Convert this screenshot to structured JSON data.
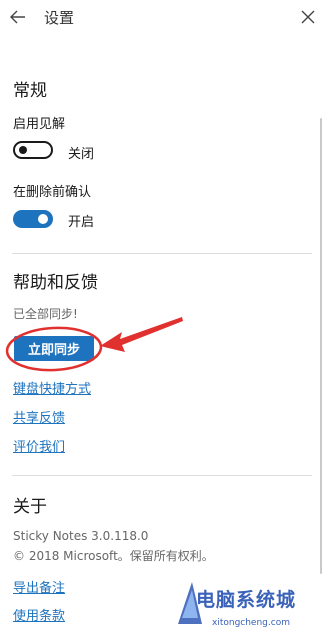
{
  "header": {
    "title": "设置"
  },
  "general": {
    "title": "常规",
    "insights_label": "启用见解",
    "insights_state": "关闭",
    "insights_on": false,
    "confirm_label": "在删除前确认",
    "confirm_state": "开启",
    "confirm_on": true
  },
  "help": {
    "title": "帮助和反馈",
    "sync_status": "已全部同步!",
    "sync_button": "立即同步",
    "links": [
      "键盘快捷方式",
      "共享反馈",
      "评价我们"
    ]
  },
  "about": {
    "title": "关于",
    "version": "Sticky Notes 3.0.118.0",
    "copyright": "© 2018 Microsoft。保留所有权利。",
    "links": [
      "导出备注",
      "使用条款"
    ]
  },
  "watermark": {
    "text": "电脑系统城",
    "sub": "xitongcheng.com"
  },
  "colors": {
    "accent": "#1e73be",
    "annotation": "#e0312f",
    "watermark": "#3a62b8"
  },
  "icons": [
    "back-arrow-icon",
    "close-icon",
    "watermark-logo-icon"
  ]
}
